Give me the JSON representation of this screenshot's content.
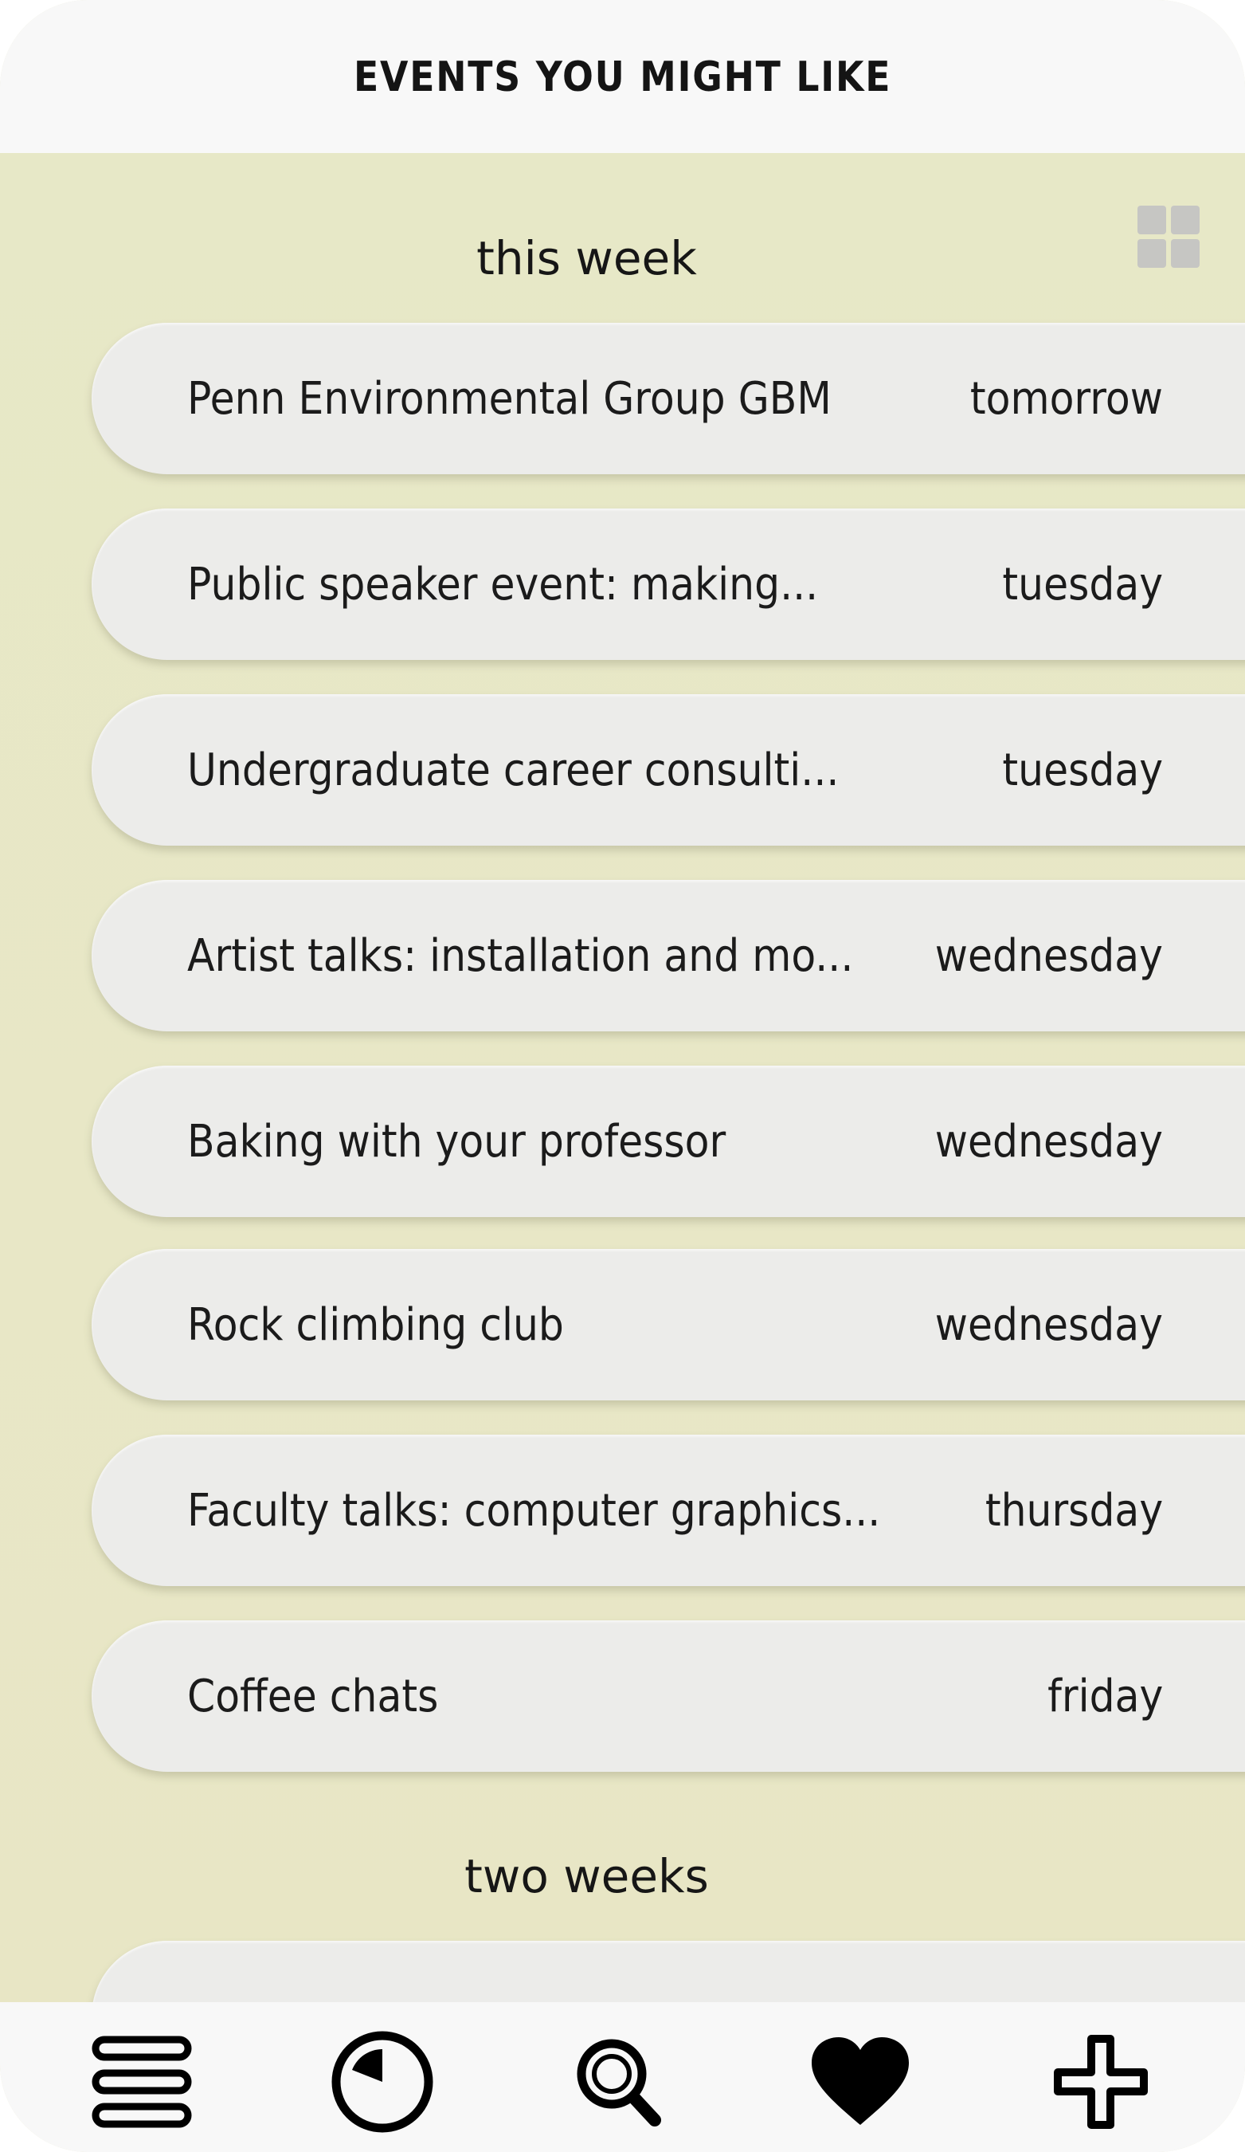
{
  "header": {
    "title": "EVENTS YOU MIGHT LIKE"
  },
  "view_toggle": {
    "icon": "grid-icon"
  },
  "sections": [
    {
      "heading": "this week",
      "events": [
        {
          "name": "Penn Environmental Group GBM",
          "day": "tomorrow"
        },
        {
          "name": "Public speaker event: making...",
          "day": "tuesday"
        },
        {
          "name": "Undergraduate career consulti...",
          "day": "tuesday"
        },
        {
          "name": "Artist talks: installation and mo...",
          "day": "wednesday"
        },
        {
          "name": "Baking with your professor",
          "day": "wednesday"
        },
        {
          "name": "Rock climbing club",
          "day": "wednesday"
        },
        {
          "name": "Faculty talks: computer graphics...",
          "day": "thursday"
        },
        {
          "name": "Coffee chats",
          "day": "friday"
        }
      ]
    },
    {
      "heading": "two weeks",
      "events": [
        {
          "name": "",
          "day": ""
        }
      ]
    }
  ],
  "bottom_nav": {
    "items": [
      {
        "icon": "menu-icon"
      },
      {
        "icon": "clock-icon"
      },
      {
        "icon": "search-icon"
      },
      {
        "icon": "heart-icon"
      },
      {
        "icon": "plus-icon"
      }
    ]
  },
  "colors": {
    "background": "#e7e8c7",
    "card": "#ececea",
    "bar": "#f8f8f8",
    "text": "#141414",
    "grid_icon": "#c6c6c3"
  }
}
